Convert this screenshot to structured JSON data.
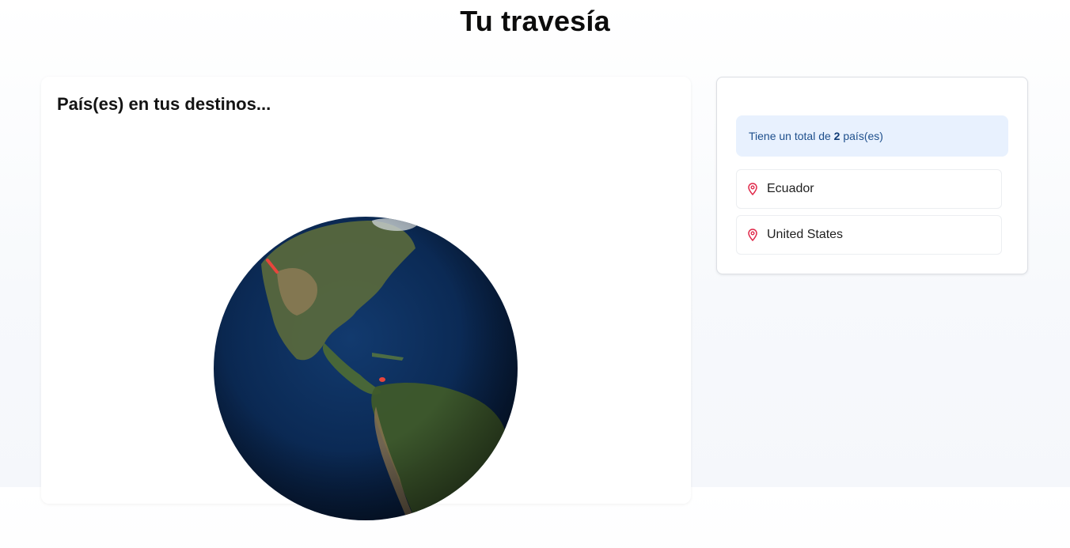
{
  "header": {
    "title": "Tu travesía"
  },
  "globe_card": {
    "title": "País(es) en tus destinos..."
  },
  "summary": {
    "prefix": "Tiene un total de ",
    "count": "2",
    "suffix": " país(es)"
  },
  "countries": [
    {
      "name": "Ecuador",
      "icon": "map-pin-icon"
    },
    {
      "name": "United States",
      "icon": "map-pin-icon"
    }
  ],
  "colors": {
    "pin": "#e0294a",
    "highlight": "#e8453c",
    "info_bg": "#e8f1fe",
    "info_text": "#1e4f8c"
  }
}
